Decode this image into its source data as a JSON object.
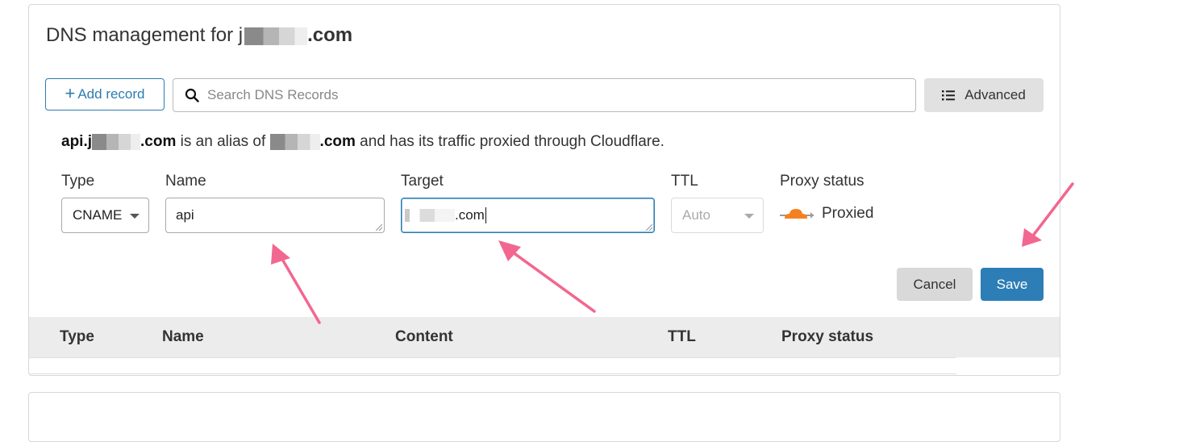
{
  "title": {
    "prefix": "DNS management for ",
    "masked_start": "j",
    "suffix": ".com"
  },
  "toolbar": {
    "add_plus": "+",
    "add_label": "Add record",
    "search_placeholder": "Search DNS Records",
    "advanced_label": "Advanced"
  },
  "alias": {
    "name_start": "api.j",
    "name_end": ".com",
    "middle": " is an alias of ",
    "target_end": ".com",
    "trailing": " and has its traffic proxied through Cloudflare."
  },
  "form": {
    "type_label": "Type",
    "type_value": "CNAME",
    "name_label": "Name",
    "name_value": "api",
    "target_label": "Target",
    "target_value": ".com",
    "ttl_label": "TTL",
    "ttl_value": "Auto",
    "proxy_label": "Proxy status",
    "proxy_value": "Proxied",
    "cancel_label": "Cancel",
    "save_label": "Save"
  },
  "table": {
    "columns": [
      "Type",
      "Name",
      "Content",
      "TTL",
      "Proxy status"
    ]
  },
  "colors": {
    "accent": "#2d7eb6",
    "annotation_arrow": "#f2678f",
    "proxy_cloud": "#f48120"
  }
}
